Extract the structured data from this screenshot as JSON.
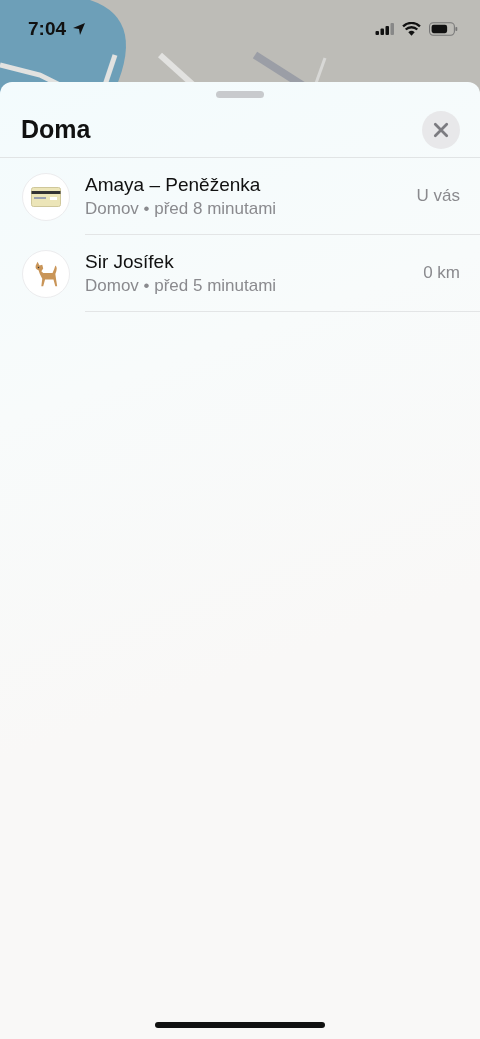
{
  "status_bar": {
    "time": "7:04"
  },
  "sheet": {
    "title": "Doma"
  },
  "items": [
    {
      "name": "Amaya – Peněženka",
      "subtitle": "Domov • před 8 minutami",
      "distance": "U vás",
      "kind": "card"
    },
    {
      "name": "Sir Josífek",
      "subtitle": "Domov • před 5 minutami",
      "distance": "0 km",
      "kind": "dog"
    }
  ]
}
